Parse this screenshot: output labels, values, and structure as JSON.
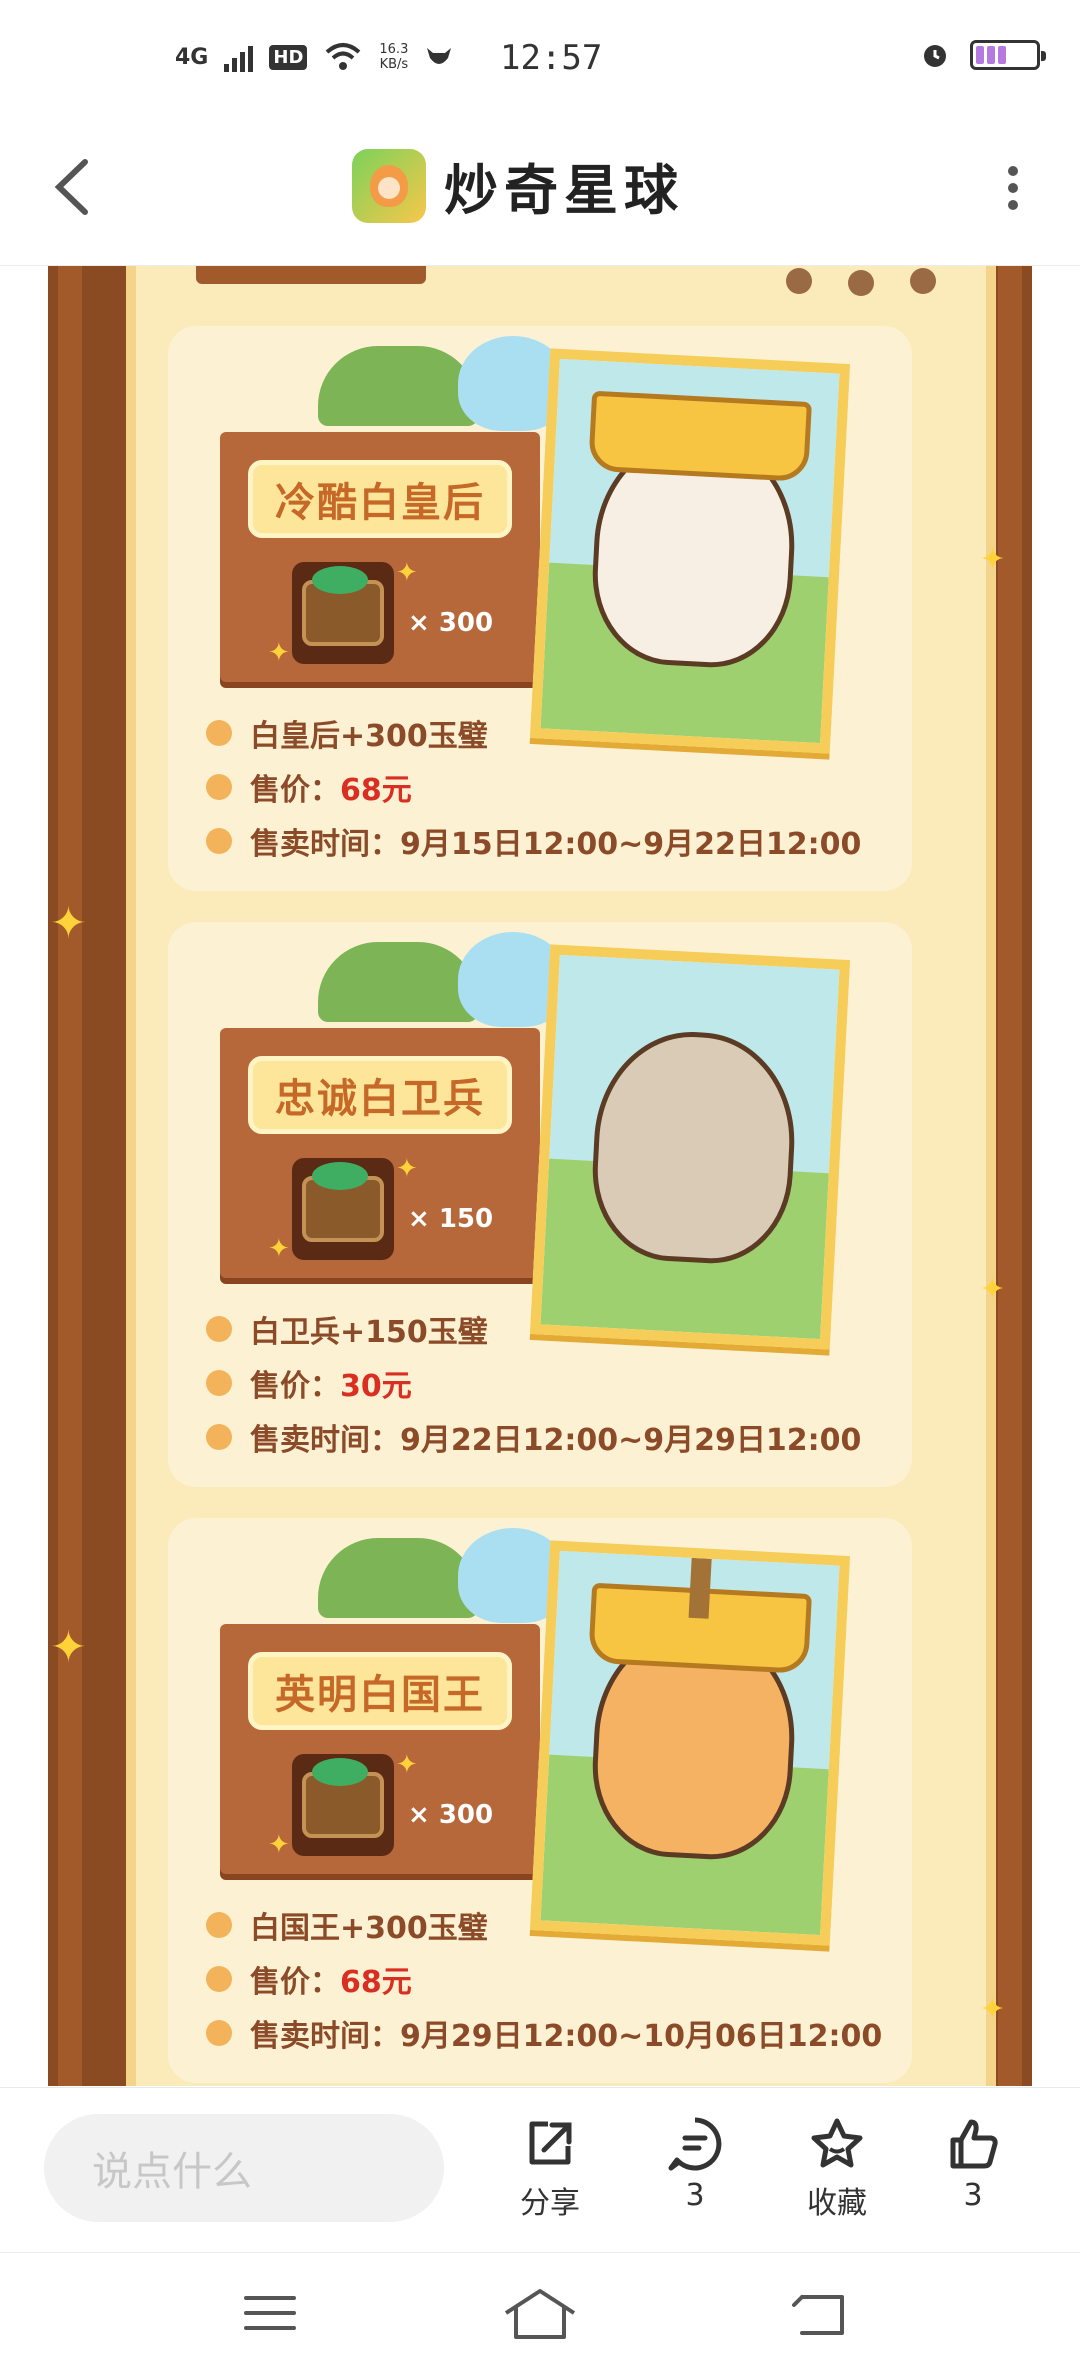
{
  "status_bar": {
    "network": "4G",
    "hd": "HD",
    "speed_value": "16.3",
    "speed_unit": "KB/s",
    "time": "12:57"
  },
  "app_bar": {
    "title": "炒奇星球"
  },
  "cards": [
    {
      "banner": "冷酷白皇后",
      "quantity": "× 300",
      "line1": "白皇后+300玉璧",
      "price_label": "售价：",
      "price_value": "68元",
      "time_label": "售卖时间：",
      "time_value": "9月15日12:00~9月22日12:00"
    },
    {
      "banner": "忠诚白卫兵",
      "quantity": "× 150",
      "line1": "白卫兵+150玉璧",
      "price_label": "售价：",
      "price_value": "30元",
      "time_label": "售卖时间：",
      "time_value": "9月22日12:00~9月29日12:00"
    },
    {
      "banner": "英明白国王",
      "quantity": "× 300",
      "line1": "白国王+300玉璧",
      "price_label": "售价：",
      "price_value": "68元",
      "time_label": "售卖时间：",
      "time_value": "9月29日12:00~10月06日12:00"
    }
  ],
  "bottom_bar": {
    "comment_placeholder": "说点什么",
    "share_label": "分享",
    "comment_count": "3",
    "favorite_label": "收藏",
    "like_count": "3"
  },
  "colors": {
    "accent_brown": "#8b4a28",
    "price_red": "#d92f23",
    "card_bg": "#fdf1d3"
  }
}
